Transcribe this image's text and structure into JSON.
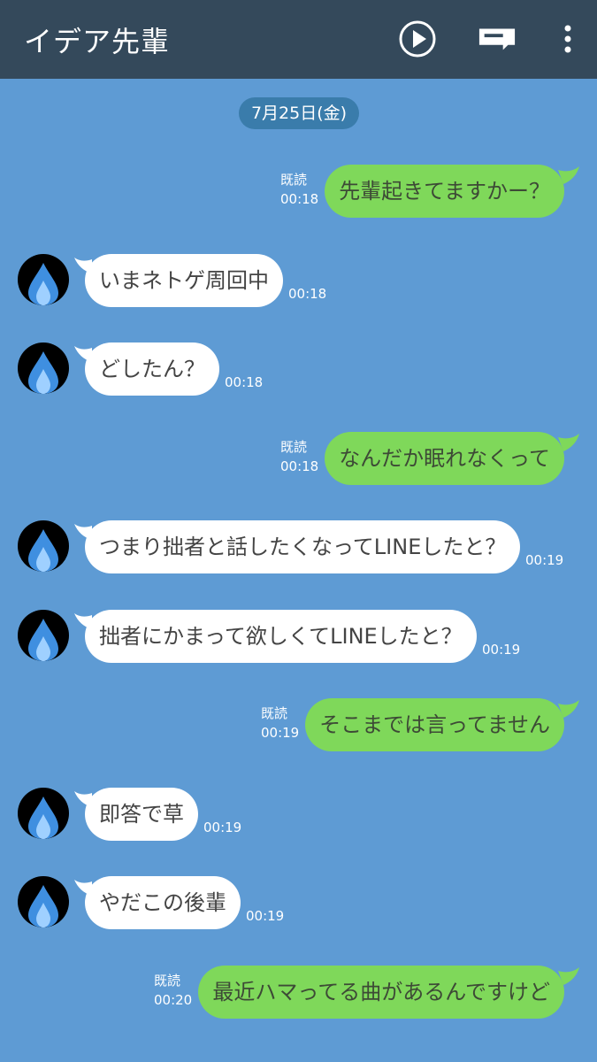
{
  "header": {
    "title": "イデア先輩",
    "icons": [
      "play-icon",
      "keyboard-icon",
      "more-icon"
    ]
  },
  "chat": {
    "date": "7月25日(金)",
    "messages": [
      {
        "side": "out",
        "text": "先輩起きてますかー？",
        "read": "既読",
        "time": "00:18"
      },
      {
        "side": "in",
        "text": "いまネトゲ周回中",
        "time": "00:18"
      },
      {
        "side": "in",
        "text": "どしたん？",
        "time": "00:18"
      },
      {
        "side": "out",
        "text": "なんだか眠れなくって",
        "read": "既読",
        "time": "00:18"
      },
      {
        "side": "in",
        "text": "つまり拙者と話したくなってLINEしたと？",
        "time": "00:19"
      },
      {
        "side": "in",
        "text": "拙者にかまって欲しくてLINEしたと？",
        "time": "00:19"
      },
      {
        "side": "out",
        "text": "そこまでは言ってません",
        "read": "既読",
        "time": "00:19"
      },
      {
        "side": "in",
        "text": "即答で草",
        "time": "00:19"
      },
      {
        "side": "in",
        "text": "やだこの後輩",
        "time": "00:19"
      },
      {
        "side": "out",
        "text": "最近ハマってる曲があるんですけど",
        "read": "既読",
        "time": "00:20"
      }
    ]
  },
  "colors": {
    "header_bg": "#34495b",
    "chat_bg": "#5e9bd4",
    "out_bubble": "#7fd85a",
    "in_bubble": "#ffffff",
    "date_chip": "#3a7cab"
  }
}
